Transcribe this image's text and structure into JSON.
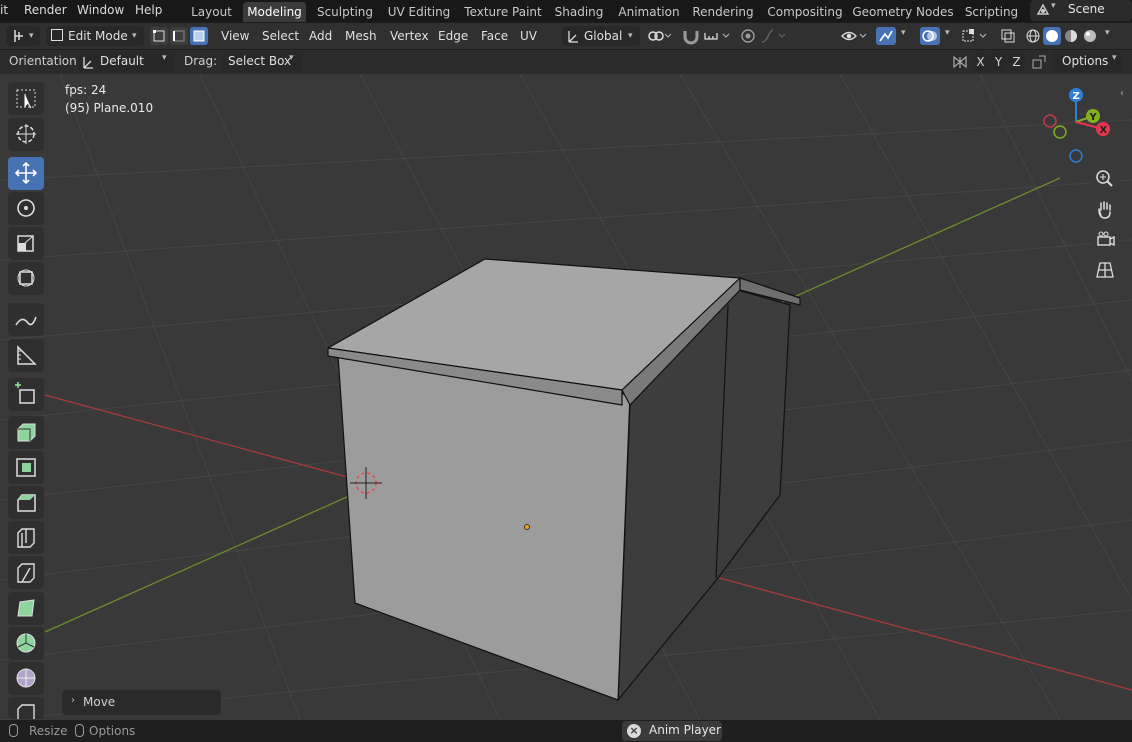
{
  "menus": [
    {
      "label": "it"
    },
    {
      "label": "Render"
    },
    {
      "label": "Window"
    },
    {
      "label": "Help"
    }
  ],
  "workspaces": [
    {
      "label": "Layout"
    },
    {
      "label": "Modeling"
    },
    {
      "label": "Sculpting"
    },
    {
      "label": "UV Editing"
    },
    {
      "label": "Texture Paint"
    },
    {
      "label": "Shading"
    },
    {
      "label": "Animation"
    },
    {
      "label": "Rendering"
    },
    {
      "label": "Compositing"
    },
    {
      "label": "Geometry Nodes"
    },
    {
      "label": "Scripting"
    }
  ],
  "scene_label": "Scene",
  "header": {
    "mode": "Edit Mode",
    "menu_items": [
      "View",
      "Select",
      "Add",
      "Mesh",
      "Vertex",
      "Edge",
      "Face",
      "UV"
    ],
    "transform_orientation": "Global"
  },
  "toolsettings": {
    "orientation_label": "Orientation:",
    "orientation_value": "Default",
    "drag_label": "Drag:",
    "drag_value": "Select Box",
    "axis_x": "X",
    "axis_y": "Y",
    "axis_z": "Z",
    "options_label": "Options"
  },
  "viewport": {
    "fps_text": "fps: 24",
    "object_text": "(95) Plane.010",
    "gizmo_z": "Z",
    "gizmo_y": "Y",
    "gizmo_x": "X"
  },
  "last_operator": "Move",
  "statusbar": {
    "resize": "Resize",
    "options": "Options",
    "anim_player": "Anim Player"
  },
  "colors": {
    "accent": "#4772b3",
    "grid_x_axis": "#a83a3a",
    "grid_y_axis": "#6d8b2c",
    "gizmo_x": "#e8354d",
    "gizmo_y": "#84b01d",
    "gizmo_z": "#2e7fd6"
  }
}
